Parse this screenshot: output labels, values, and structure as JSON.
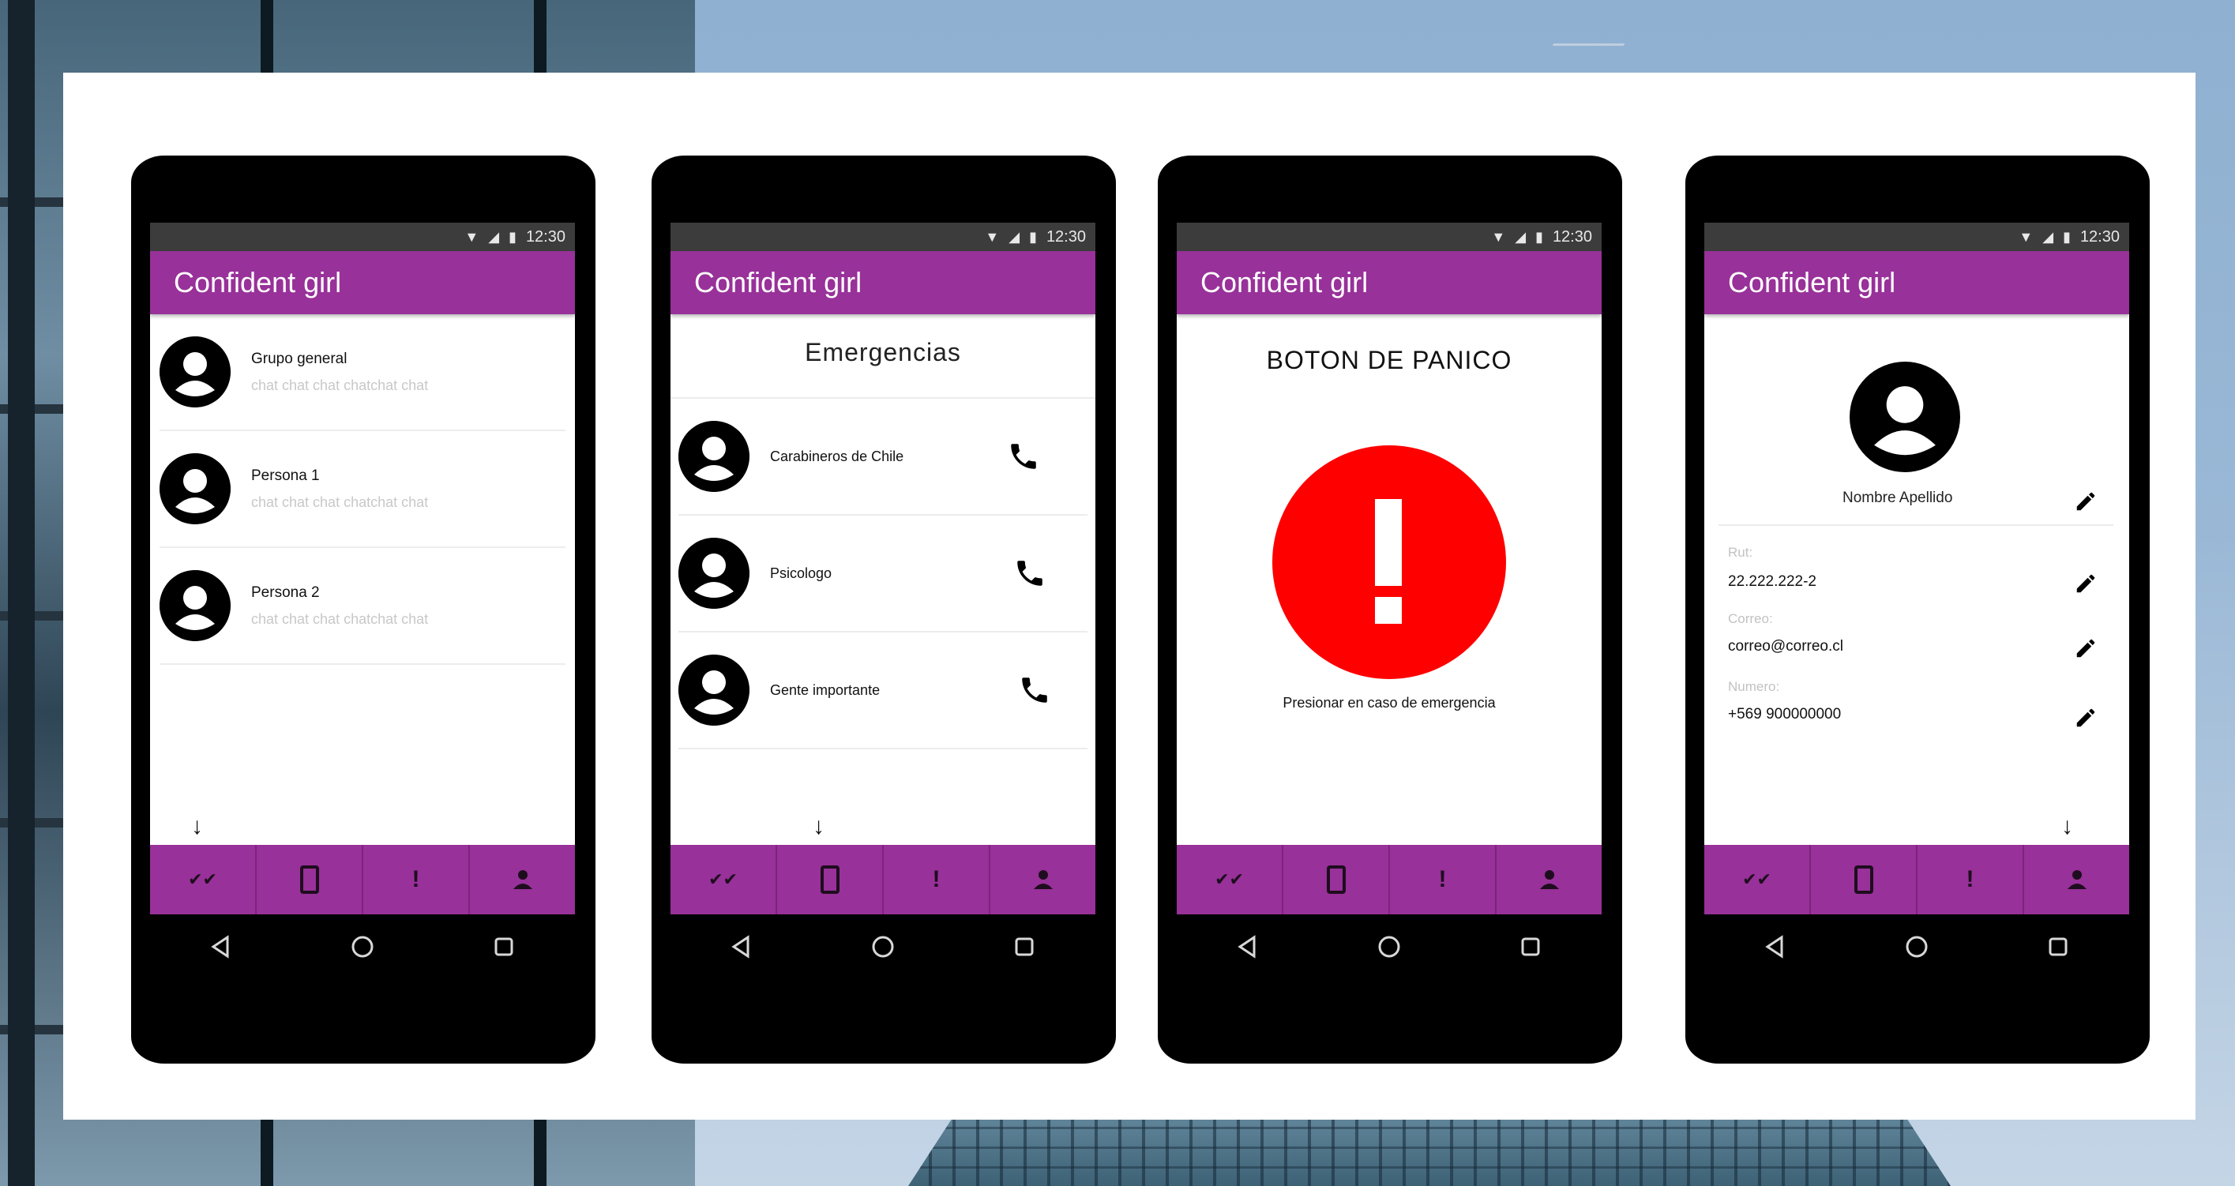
{
  "app": {
    "title": "Confident girl",
    "status_time": "12:30",
    "accent_color": "#983199",
    "panic_color": "#ff0000"
  },
  "bottom_tabs": [
    {
      "icon": "double-check-icon",
      "glyph": "✔✔"
    },
    {
      "icon": "phone-device-icon",
      "glyph": "▯"
    },
    {
      "icon": "exclamation-icon",
      "glyph": "!"
    },
    {
      "icon": "person-icon",
      "glyph": "●"
    }
  ],
  "chats_screen": {
    "items": [
      {
        "name": "Grupo general",
        "preview": "chat chat chat chatchat chat"
      },
      {
        "name": "Persona 1",
        "preview": "chat chat chat chatchat chat"
      },
      {
        "name": "Persona 2",
        "preview": "chat chat chat chatchat chat"
      }
    ]
  },
  "emergency_screen": {
    "title": "Emergencias",
    "contacts": [
      {
        "label": "Carabineros de Chile"
      },
      {
        "label": "Psicologo"
      },
      {
        "label": "Gente importante"
      }
    ]
  },
  "panic_screen": {
    "title": "BOTON DE PANICO",
    "caption": "Presionar en caso de emergencia"
  },
  "profile_screen": {
    "name": "Nombre Apellido",
    "fields": [
      {
        "label": "Rut:",
        "value": "22.222.222-2"
      },
      {
        "label": "Correo:",
        "value": "correo@correo.cl"
      },
      {
        "label": "Numero:",
        "value": "+569 900000000"
      }
    ]
  },
  "scroll_hint": "↓"
}
